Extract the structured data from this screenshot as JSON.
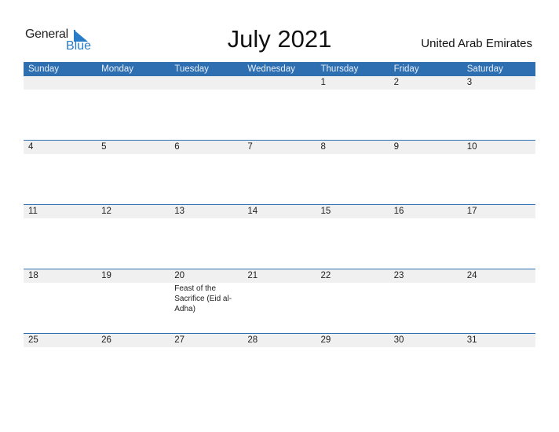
{
  "brand": {
    "word1": "General",
    "word2": "Blue",
    "accent_color": "#2a7bc8"
  },
  "header": {
    "title": "July 2021",
    "country": "United Arab Emirates"
  },
  "calendar": {
    "header_color": "#2e6fb2",
    "weekdays": [
      "Sunday",
      "Monday",
      "Tuesday",
      "Wednesday",
      "Thursday",
      "Friday",
      "Saturday"
    ],
    "weeks": [
      {
        "days": [
          "",
          "",
          "",
          "",
          "1",
          "2",
          "3"
        ],
        "events": [
          "",
          "",
          "",
          "",
          "",
          "",
          ""
        ]
      },
      {
        "days": [
          "4",
          "5",
          "6",
          "7",
          "8",
          "9",
          "10"
        ],
        "events": [
          "",
          "",
          "",
          "",
          "",
          "",
          ""
        ]
      },
      {
        "days": [
          "11",
          "12",
          "13",
          "14",
          "15",
          "16",
          "17"
        ],
        "events": [
          "",
          "",
          "",
          "",
          "",
          "",
          ""
        ]
      },
      {
        "days": [
          "18",
          "19",
          "20",
          "21",
          "22",
          "23",
          "24"
        ],
        "events": [
          "",
          "",
          "Feast of the Sacrifice (Eid al-Adha)",
          "",
          "",
          "",
          ""
        ]
      },
      {
        "days": [
          "25",
          "26",
          "27",
          "28",
          "29",
          "30",
          "31"
        ],
        "events": [
          "",
          "",
          "",
          "",
          "",
          "",
          ""
        ]
      }
    ]
  }
}
